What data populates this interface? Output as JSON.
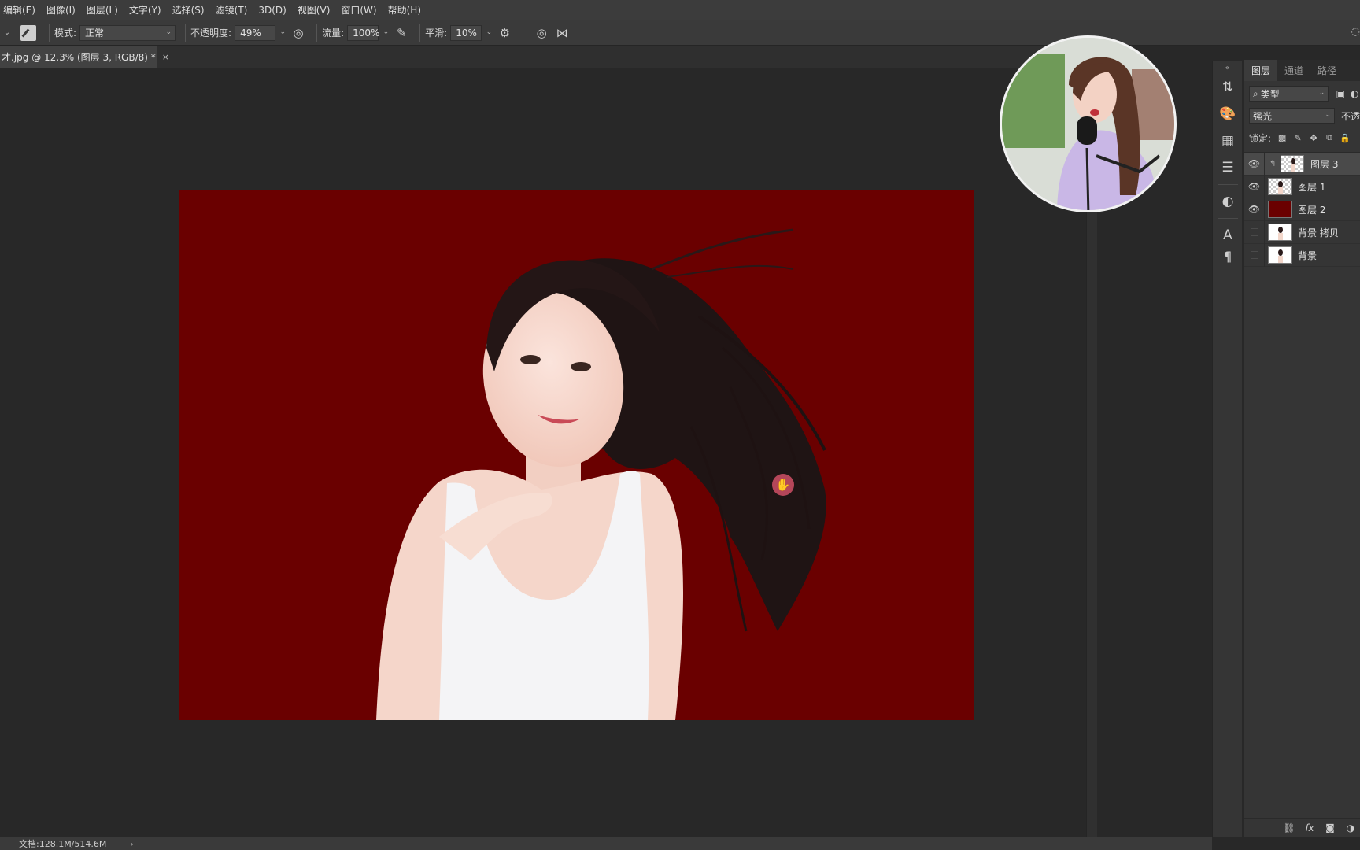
{
  "menu": [
    "编辑(E)",
    "图像(I)",
    "图层(L)",
    "文字(Y)",
    "选择(S)",
    "滤镜(T)",
    "3D(D)",
    "视图(V)",
    "窗口(W)",
    "帮助(H)"
  ],
  "options": {
    "mode_label": "模式:",
    "mode_value": "正常",
    "opacity_label": "不透明度:",
    "opacity_value": "49%",
    "flow_label": "流量:",
    "flow_value": "100%",
    "smoothing_label": "平滑:",
    "smoothing_value": "10%"
  },
  "document_tab": {
    "title": "才.jpg @ 12.3% (图层 3, RGB/8) *",
    "close": "×"
  },
  "layers_panel": {
    "tabs": [
      "图层",
      "通道",
      "路径"
    ],
    "filter_kind": "类型",
    "blend_mode": "强光",
    "opacity_label_partial": "不透",
    "lock_label": "锁定:",
    "layers": [
      {
        "name": "图层 3",
        "visible": true,
        "selected": true,
        "linked": true,
        "thumb": "transparent-figure"
      },
      {
        "name": "图层 1",
        "visible": true,
        "selected": false,
        "linked": false,
        "thumb": "transparent-figure"
      },
      {
        "name": "图层 2",
        "visible": true,
        "selected": false,
        "linked": false,
        "thumb": "red-fill"
      },
      {
        "name": "背景 拷贝",
        "visible": false,
        "selected": false,
        "linked": false,
        "thumb": "photo"
      },
      {
        "name": "背景",
        "visible": false,
        "selected": false,
        "linked": false,
        "thumb": "photo"
      }
    ]
  },
  "status": {
    "doc_size": "文档:128.1M/514.6M",
    "arrow": "›"
  },
  "colors": {
    "canvas_background": "#6a0000",
    "hand_cursor": "#b44659"
  }
}
